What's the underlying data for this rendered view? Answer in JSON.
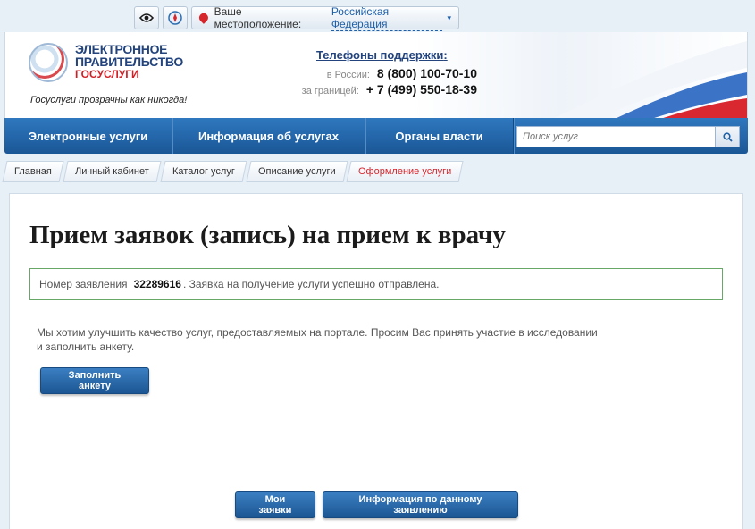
{
  "topbar": {
    "location_label": "Ваше местоположение:",
    "location_value": "Российская Федерация",
    "icons": [
      "eye-icon",
      "compass-icon",
      "location-pin-icon"
    ]
  },
  "header": {
    "logo": {
      "line1": "ЭЛЕКТРОННОЕ",
      "line2": "ПРАВИТЕЛЬСТВО",
      "line3": "ГОСУСЛУГИ"
    },
    "slogan": "Госуслуги прозрачны как никогда!",
    "support": {
      "title": "Телефоны поддержки",
      "title_suffix": ":",
      "russia_label": "в России:",
      "russia_phone": "8 (800) 100-70-10",
      "abroad_label": "за границей:",
      "abroad_phone": "+ 7 (499) 550-18-39"
    }
  },
  "nav": {
    "items": [
      "Электронные услуги",
      "Информация об услугах",
      "Органы власти"
    ],
    "search_placeholder": "Поиск услуг"
  },
  "breadcrumbs": [
    "Главная",
    "Личный кабинет",
    "Каталог услуг",
    "Описание услуги",
    "Оформление услуги"
  ],
  "main": {
    "title": "Прием заявок (запись) на прием к врачу",
    "notice": {
      "prefix": "Номер заявления",
      "number": "32289616",
      "suffix": ". Заявка на получение услуги успешно отправлена."
    },
    "survey_text_1": "Мы хотим улучшить качество услуг, предоставляемых на портале. Просим Вас принять участие в исследовании",
    "survey_text_2": "и заполнить анкету.",
    "survey_button": "Заполнить анкету",
    "my_requests_button": "Мои заявки",
    "request_info_button": "Информация по данному заявлению"
  },
  "colors": {
    "nav_blue": "#1f62a8",
    "accent_red": "#d6262c",
    "notice_border": "#67a866",
    "logo_blue": "#22437c"
  }
}
